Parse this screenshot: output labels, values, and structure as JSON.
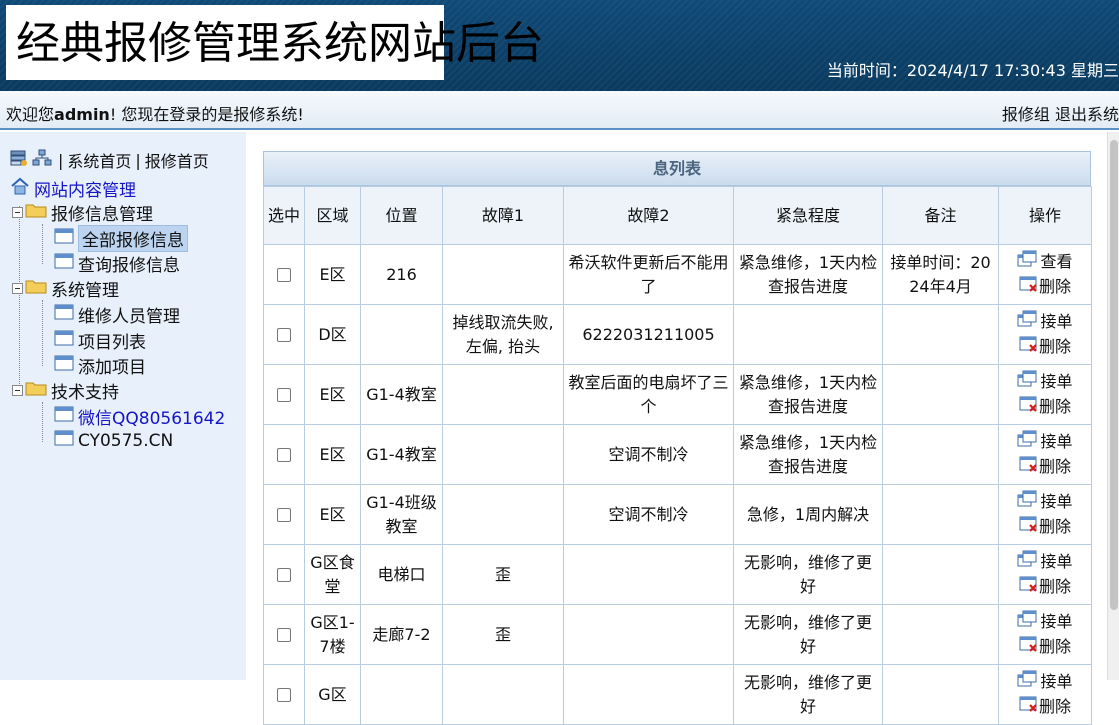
{
  "header": {
    "title": "经典报修管理系统网站后台",
    "clock_label": "当前时间：",
    "clock_value": "2024/4/17 17:30:43 星期三"
  },
  "welcome": {
    "prefix": "欢迎您",
    "user": "admin",
    "suffix": "! 您现在登录的是报修系统!",
    "right_group": "报修组",
    "logout": "退出系统"
  },
  "sidebar": {
    "home_link": "系统首页",
    "repair_home_link": "报修首页",
    "separator": "|",
    "root": "网站内容管理",
    "groups": [
      {
        "label": "报修信息管理",
        "items": [
          "全部报修信息",
          "查询报修信息"
        ]
      },
      {
        "label": "系统管理",
        "items": [
          "维修人员管理",
          "项目列表",
          "添加项目"
        ]
      },
      {
        "label": "技术支持",
        "items": [
          "微信QQ80561642",
          "CY0575.CN"
        ]
      }
    ]
  },
  "table": {
    "title": "息列表",
    "headers": [
      "选中",
      "区域",
      "位置",
      "故障1",
      "故障2",
      "紧急程度",
      "备注",
      "操作"
    ],
    "rows": [
      {
        "area": "E区",
        "location": "216",
        "fault1": "",
        "fault2": "希沃软件更新后不能用了",
        "urgency": "紧急维修，1天内检查报告进度",
        "note": "接单时间：2024年4月",
        "action": "查看",
        "delete": "删除"
      },
      {
        "area": "D区",
        "location": "",
        "fault1": "掉线取流失败, 左偏, 抬头",
        "fault2": "6222031211005",
        "urgency": "",
        "note": "",
        "action": "接单",
        "delete": "删除"
      },
      {
        "area": "E区",
        "location": "G1-4教室",
        "fault1": "",
        "fault2": "教室后面的电扇坏了三个",
        "urgency": "紧急维修，1天内检查报告进度",
        "note": "",
        "action": "接单",
        "delete": "删除"
      },
      {
        "area": "E区",
        "location": "G1-4教室",
        "fault1": "",
        "fault2": "空调不制冷",
        "urgency": "紧急维修，1天内检查报告进度",
        "note": "",
        "action": "接单",
        "delete": "删除"
      },
      {
        "area": "E区",
        "location": "G1-4班级教室",
        "fault1": "",
        "fault2": "空调不制冷",
        "urgency": "急修，1周内解决",
        "note": "",
        "action": "接单",
        "delete": "删除"
      },
      {
        "area": "G区食堂",
        "location": "电梯口",
        "fault1": "歪",
        "fault2": "",
        "urgency": "无影响，维修了更好",
        "note": "",
        "action": "接单",
        "delete": "删除"
      },
      {
        "area": "G区1-7楼",
        "location": "走廊7-2",
        "fault1": "歪",
        "fault2": "",
        "urgency": "无影响，维修了更好",
        "note": "",
        "action": "接单",
        "delete": "删除"
      },
      {
        "area": "G区",
        "location": "",
        "fault1": "",
        "fault2": "",
        "urgency": "无影响，维修了更好",
        "note": "",
        "action": "接单",
        "delete": "删除"
      }
    ]
  },
  "colors": {
    "header_bg": "#0c4068",
    "sidebar_bg": "#e7f0fb",
    "link_blue": "#1515c8",
    "table_border": "#b8cde2"
  }
}
